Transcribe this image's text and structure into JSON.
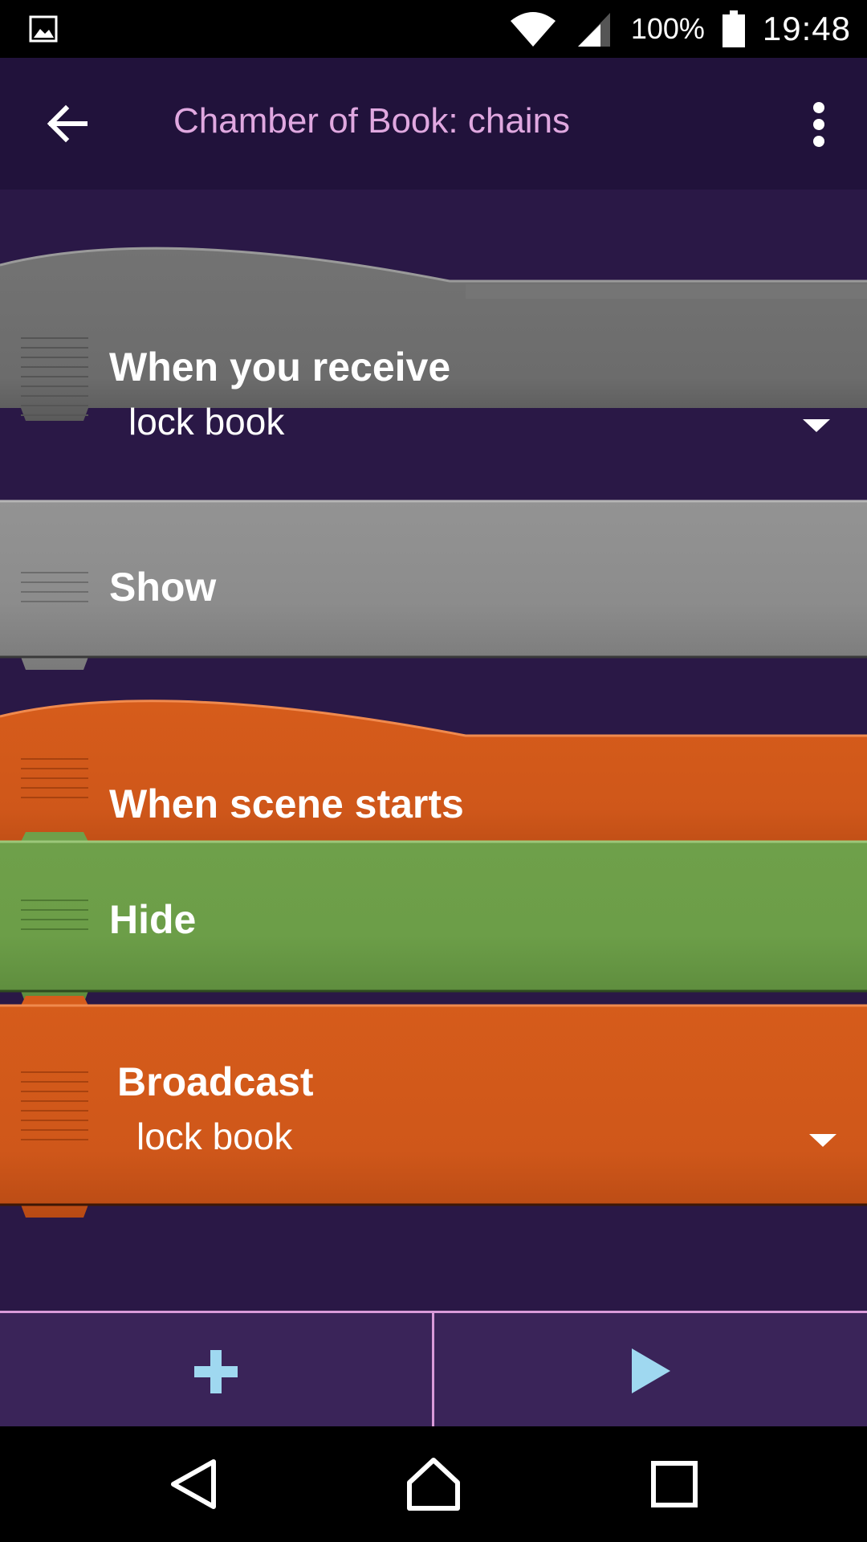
{
  "status_bar": {
    "battery_percent": "100%",
    "time": "19:48",
    "icons": [
      "image-notification-icon",
      "wifi-icon",
      "signal-icon",
      "battery-icon"
    ]
  },
  "app_bar": {
    "title": "Chamber of Book: chains",
    "back_icon": "arrow-left-icon",
    "menu_icon": "more-vertical-icon"
  },
  "scripts": [
    {
      "hat": {
        "label": "When you receive",
        "value": "lock book",
        "color": "#6e6e6e"
      },
      "bricks": [
        {
          "label": "Show",
          "color": "#8c8c8c"
        }
      ]
    },
    {
      "hat": {
        "label": "When scene starts",
        "color": "#d35a1a"
      },
      "bricks": [
        {
          "label": "Hide",
          "color": "#6c9e48"
        },
        {
          "label": "Broadcast",
          "value": "lock book",
          "color": "#d35a1a"
        }
      ]
    }
  ],
  "bottom_bar": {
    "add_icon": "plus-icon",
    "play_icon": "play-icon",
    "accent_color": "#9fd8f0"
  },
  "nav_bar": {
    "icons": [
      "back-triangle-icon",
      "home-icon",
      "recents-square-icon"
    ]
  }
}
